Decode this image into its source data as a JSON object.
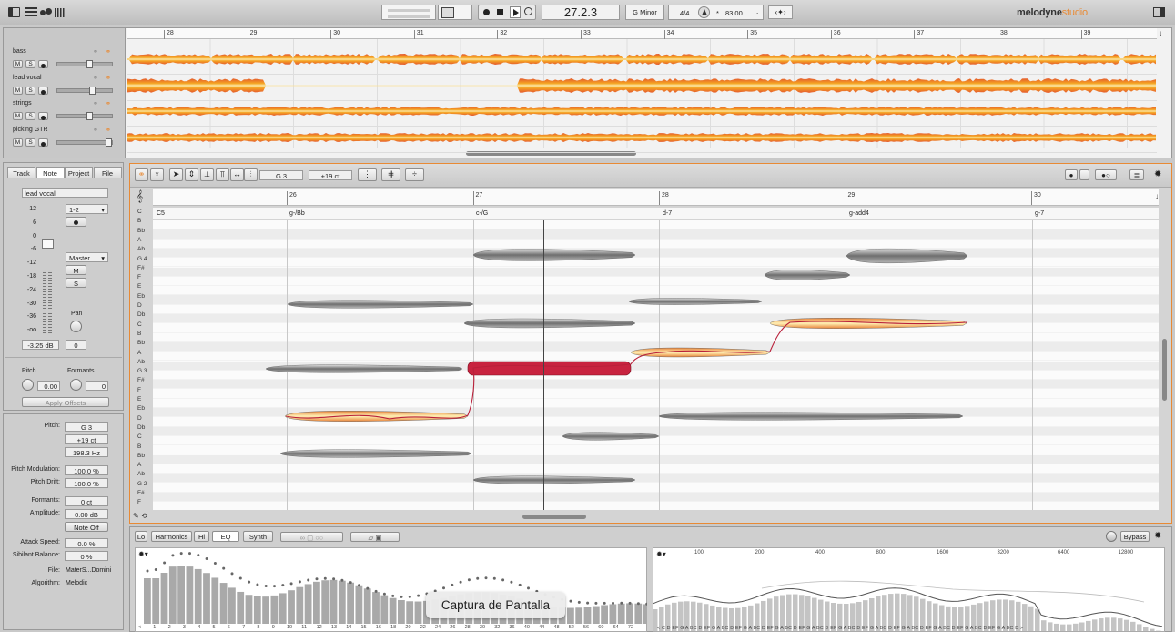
{
  "app": {
    "brand": "melodyne",
    "brand_suffix": "studio"
  },
  "transport": {
    "position": "27.2.3",
    "key": "G Minor",
    "meter": "4/4",
    "tempo": "83.00",
    "tempo_prefix": "*",
    "tempo_suffix": "."
  },
  "arrangement": {
    "bars": [
      "28",
      "29",
      "30",
      "31",
      "32",
      "33",
      "34",
      "35",
      "36",
      "37",
      "38",
      "39"
    ],
    "tracks": [
      {
        "name": "bass",
        "m": "M",
        "s": "S"
      },
      {
        "name": "lead vocal",
        "m": "M",
        "s": "S"
      },
      {
        "name": "strings",
        "m": "M",
        "s": "S"
      },
      {
        "name": "picking GTR",
        "m": "M",
        "s": "S"
      }
    ]
  },
  "inspector": {
    "tabs": [
      "Track",
      "Note",
      "Project",
      "File"
    ],
    "active_tab": "Note",
    "track_name": "lead vocal",
    "meter_scale": [
      "12",
      "6",
      "0",
      "-6",
      "-12",
      "-18",
      "-24",
      "-30",
      "-36",
      "-oo"
    ],
    "input_sel": "1-2",
    "output_sel": "Master",
    "m": "M",
    "s": "S",
    "pan_label": "Pan",
    "volume": "-3.25 dB",
    "pan_value": "0",
    "pitch_label": "Pitch",
    "formants_label": "Formants",
    "pitch_val": "0.00",
    "formants_val": "0",
    "apply_offsets": "Apply Offsets"
  },
  "note_props": {
    "pitch_label": "Pitch:",
    "pitch": "G 3",
    "cents": "+19 ct",
    "hz": "198.3 Hz",
    "mod_label": "Pitch Modulation:",
    "mod": "100.0 %",
    "drift_label": "Pitch Drift:",
    "drift": "100.0 %",
    "formants_label": "Formants:",
    "formants": "0 ct",
    "amp_label": "Amplitude:",
    "amp": "0.00 dB",
    "note_off": "Note Off",
    "attack_label": "Attack Speed:",
    "attack": "0.0 %",
    "sibilant_label": "Sibilant Balance:",
    "sibilant": "0 %",
    "file_label": "File:",
    "file": "MaterS...Domini",
    "algo_label": "Algorithm:",
    "algo": "Melodic"
  },
  "editor": {
    "pitch_field": "G 3",
    "cents_field": "+19 ct",
    "bars": [
      "26",
      "27",
      "28",
      "29",
      "30"
    ],
    "chords": [
      "C5",
      "g-/Bb",
      "c-/G",
      "d-7",
      "g-add4",
      "g-7"
    ],
    "keys": [
      "C",
      "B",
      "Bb",
      "A",
      "Ab",
      "G 4",
      "F#",
      "F",
      "E",
      "Eb",
      "D",
      "Db",
      "C",
      "B",
      "Bb",
      "A",
      "Ab",
      "G 3",
      "F#",
      "F",
      "E",
      "Eb",
      "D",
      "Db",
      "C",
      "B",
      "Bb",
      "A",
      "Ab",
      "G 2",
      "F#",
      "F"
    ]
  },
  "sound_editor": {
    "tabs": [
      "Lo",
      "Harmonics",
      "Hi",
      "EQ",
      "Synth"
    ],
    "bypass": "Bypass",
    "left_axis": [
      "<",
      "1",
      "2",
      "3",
      "4",
      "5",
      "6",
      "7",
      "8",
      "9",
      "10",
      "11",
      "12",
      "13",
      "14",
      "15",
      "16",
      "18",
      "20",
      "22",
      "24",
      "26",
      "28",
      "30",
      "32",
      "36",
      "40",
      "44",
      "48",
      "52",
      "56",
      "60",
      "64",
      "72"
    ],
    "right_top": [
      "100",
      "200",
      "400",
      "800",
      "1600",
      "3200",
      "6400",
      "12800"
    ],
    "right_axis": "< C D EF G A BC D EF G A BC D EF G A BC D EF G A BC D EF G A BC D EF G A BC D EF G A BC D EF G A BC D EF G A BC D EF G A BC D EF G A BC D >"
  },
  "tooltip": "Captura de Pantalla",
  "colors": {
    "note_selected": "#c8233f",
    "note_active": "#f3c76d",
    "note_default": "#8a8a8a",
    "accent_orange": "#e88a35"
  }
}
